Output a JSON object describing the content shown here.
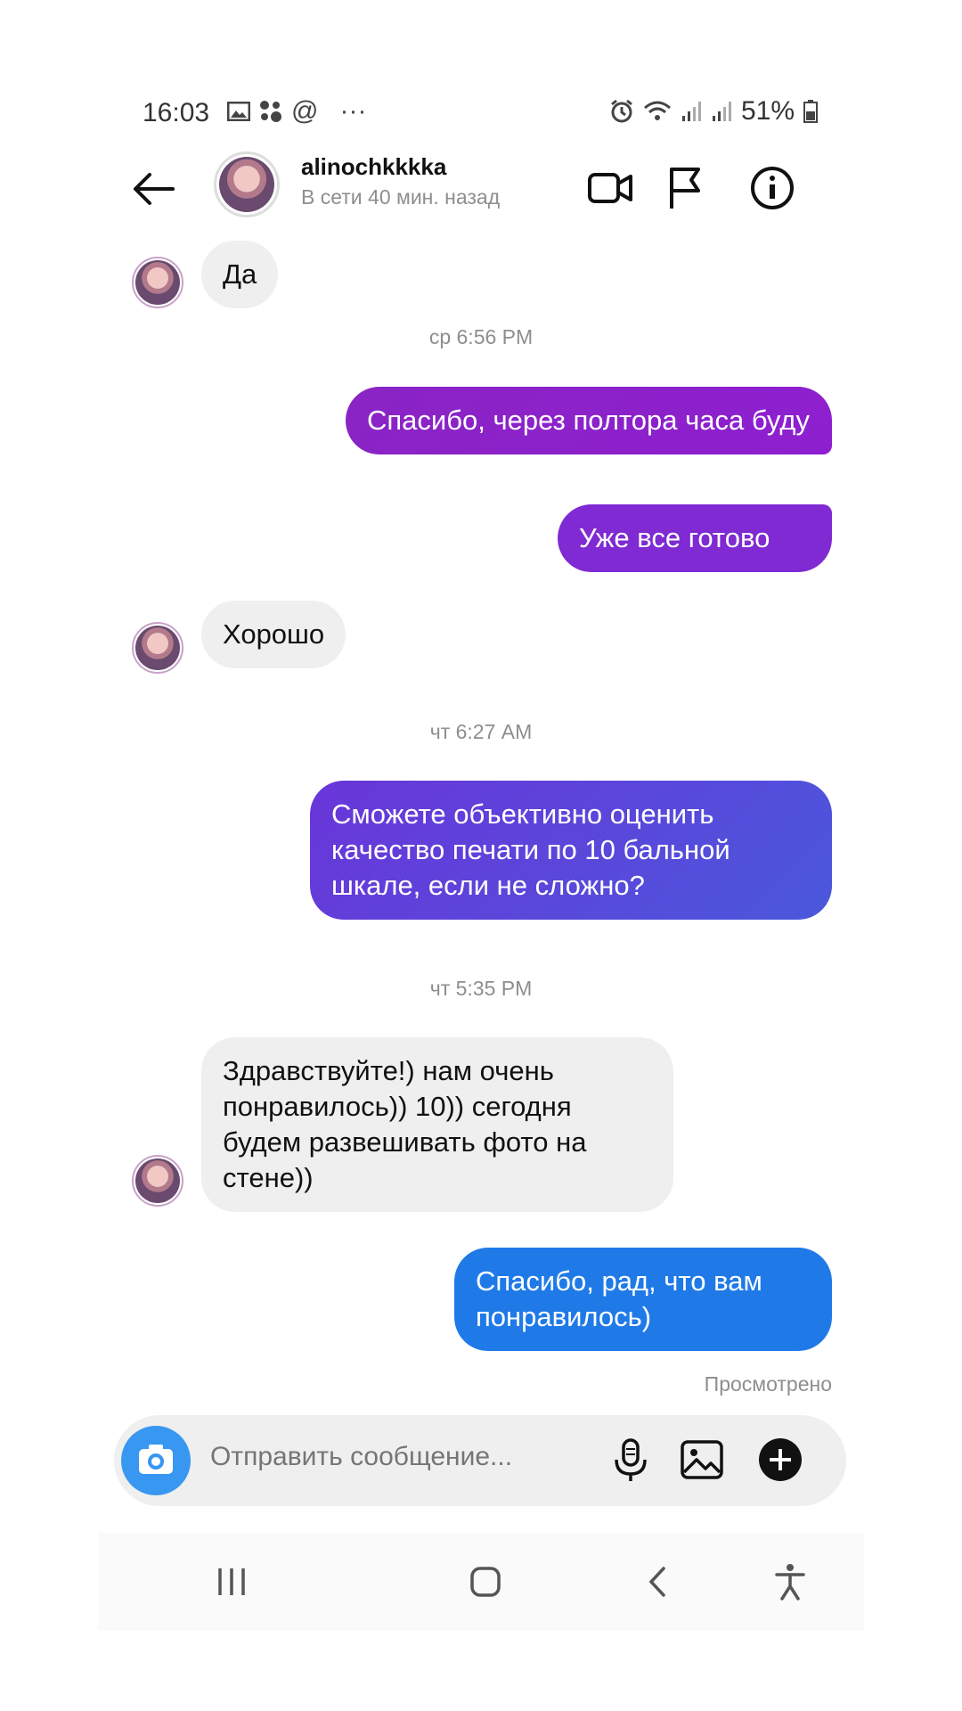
{
  "status_bar": {
    "time": "16:03",
    "left_glyphs": "▪ ⁘ @ ···",
    "battery": "51%"
  },
  "header": {
    "username": "alinochkkkka",
    "presence": "В сети 40 мин. назад",
    "icons": [
      "back-arrow-icon",
      "video-call-icon",
      "flag-icon",
      "info-icon"
    ]
  },
  "messages": {
    "m1": "Да",
    "stamp1": "ср 6:56 PM",
    "m2": "Спасибо, через полтора часа буду",
    "m3": "Уже все готово",
    "m4": "Хорошо",
    "stamp2": "чт 6:27 AM",
    "m5": "Сможете объективно оценить качество печати по 10 бальной шкале, если не сложно?",
    "stamp3": "чт 5:35 PM",
    "m6": "Здравствуйте!) нам очень понравилось)) 10)) сегодня будем развешивать фото на стене))",
    "m7": "Спасибо, рад, что вам понравилось)",
    "seen": "Просмотрено"
  },
  "composer": {
    "placeholder": "Отправить сообщение..."
  },
  "colors": {
    "purple": "#8a1fc9",
    "purple_blue": "#6a35d9",
    "blue": "#1f7ae8",
    "incoming": "#efefef"
  }
}
